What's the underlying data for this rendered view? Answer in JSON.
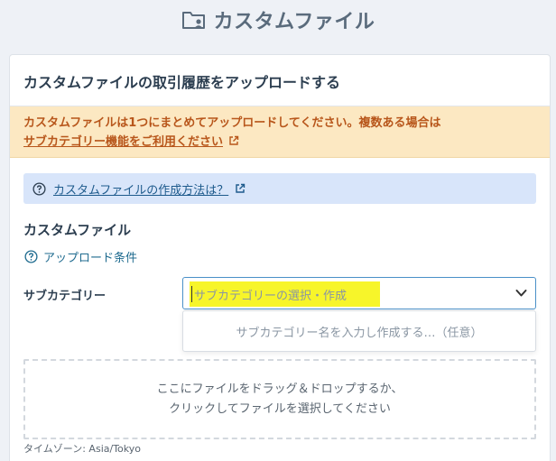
{
  "header": {
    "title": "カスタムファイル",
    "icon": "folder-user-icon"
  },
  "card": {
    "title": "カスタムファイルの取引履歴をアップロードする",
    "warning": {
      "line1": "カスタムファイルは1つにまとめてアップロードしてください。複数ある場合は",
      "link": "サブカテゴリー機能をご利用ください",
      "bg_color": "#fce8c2",
      "text_color": "#b8561b"
    },
    "info": {
      "link": "カスタムファイルの作成方法は？",
      "bg_color": "#d8e5fa"
    },
    "section_label": "カスタムファイル",
    "upload_conditions": "アップロード条件",
    "subcategory": {
      "label": "サブカテゴリー",
      "placeholder": "サブカテゴリーの選択・作成",
      "dropdown_option": "サブカテゴリー名を入力し作成する…（任意）"
    },
    "dropzone": {
      "line1": "ここにファイルをドラッグ＆ドロップするか、",
      "line2": "クリックしてファイルを選択してください"
    },
    "timezone": "タイムゾーン: Asia/Tokyo"
  }
}
